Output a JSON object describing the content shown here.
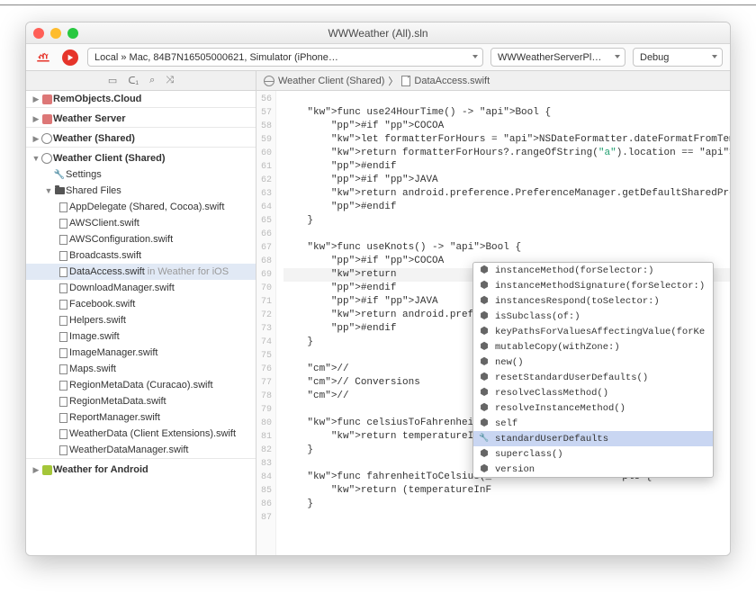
{
  "window": {
    "title": "WWWeather (All).sln"
  },
  "toolbar": {
    "target": "Local » Mac, 84B7N16505000621, Simulator (iPhone…",
    "project": "WWWeatherServerPl…",
    "config": "Debug"
  },
  "sidebar": {
    "cloud": "RemObjects.Cloud",
    "server": "Weather Server",
    "shared": "Weather (Shared)",
    "client": "Weather Client (Shared)",
    "settings": "Settings",
    "sharedfiles": "Shared Files",
    "files": {
      "f0": "AppDelegate (Shared, Cocoa).swift",
      "f1": "AWSClient.swift",
      "f2": "AWSConfiguration.swift",
      "f3": "Broadcasts.swift",
      "f4": "DataAccess.swift",
      "f4dim": "in Weather for iOS",
      "f5": "DownloadManager.swift",
      "f6": "Facebook.swift",
      "f7": "Helpers.swift",
      "f8": "Image.swift",
      "f9": "ImageManager.swift",
      "f10": "Maps.swift",
      "f11": "RegionMetaData (Curacao).swift",
      "f12": "RegionMetaData.swift",
      "f13": "ReportManager.swift",
      "f14": "WeatherData (Client Extensions).swift",
      "f15": "WeatherDataManager.swift"
    },
    "android": "Weather for Android"
  },
  "breadcrumb": {
    "a": "Weather Client (Shared)",
    "b": "DataAccess.swift",
    "sep": "〉"
  },
  "gutter": {
    "start": 56,
    "end": 87
  },
  "code": {
    "l57": "    func use24HourTime() -> Bool {",
    "l58": "        #if COCOA",
    "l59": "        let formatterForHours = NSDateFormatter.dateFormatFromTemplate(\"j",
    "l60": "        return formatterForHours?.rangeOfString(\"a\").location == NSNotFou",
    "l61": "        #endif",
    "l62": "        #if JAVA",
    "l63": "        return android.preference.PreferenceManager.getDefaultSharedPrefe",
    "l64": "        #endif",
    "l65": "    }",
    "l67": "    func useKnots() -> Bool {",
    "l68": "        #if COCOA",
    "l69": "        return NSUserDefaults.standardUserDefaults.boolForKey(\"ShowKnots\"",
    "l70": "        #endif",
    "l71": "        #if JAVA",
    "l72": "        return android.prefere",
    "l73": "        #endif",
    "l74": "    }",
    "l76": "    //",
    "l77": "    // Conversions",
    "l78": "    //",
    "l80": "    func celsiusToFahrenheit(_",
    "l80b": "{",
    "l81": "        return temperatureInCe",
    "l82": "    }",
    "l84": "    func fahrenheitToCelsius(_",
    "l84b": "ple {",
    "l85": "        return (temperatureInF",
    "l86": "    }"
  },
  "autocomplete": {
    "items": {
      "i0": "instanceMethod(forSelector:)",
      "i1": "instanceMethodSignature(forSelector:)",
      "i2": "instancesRespond(toSelector:)",
      "i3": "isSubclass(of:)",
      "i4": "keyPathsForValuesAffectingValue(forKe",
      "i5": "mutableCopy(withZone:)",
      "i6": "new()",
      "i7": "resetStandardUserDefaults()",
      "i8": "resolveClassMethod()",
      "i9": "resolveInstanceMethod()",
      "i10": "self",
      "i11": "standardUserDefaults",
      "i12": "superclass()",
      "i13": "version"
    }
  }
}
